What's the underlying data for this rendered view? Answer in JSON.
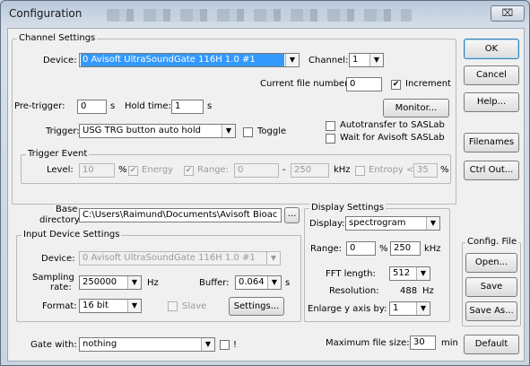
{
  "window": {
    "title": "Configuration",
    "close_glyph": "⌧"
  },
  "channel_settings": {
    "legend": "Channel Settings",
    "device_label": "Device:",
    "device_value": "0 Avisoft UltraSoundGate 116H 1.0 #1",
    "channel_label": "Channel:",
    "channel_value": "1",
    "current_file_label": "Current file number:",
    "current_file_value": "0",
    "increment_label": "Increment",
    "increment_checked": "✔",
    "pretrigger_label": "Pre-trigger:",
    "pretrigger_value": "0",
    "pretrigger_unit": "s",
    "holdtime_label": "Hold time:",
    "holdtime_value": "1",
    "holdtime_unit": "s",
    "monitor_button": "Monitor...",
    "autotransfer_label": "Autotransfer to SASLab",
    "wait_label": "Wait for Avisoft SASLab",
    "trigger_label": "Trigger:",
    "trigger_value": "USG TRG button auto hold",
    "toggle_label": "Toggle"
  },
  "trigger_event": {
    "legend": "Trigger Event",
    "level_label": "Level:",
    "level_value": "10",
    "percent": "%",
    "energy_checked": "✔",
    "energy_label": "Energy",
    "range_checked": "✔",
    "range_label": "Range:",
    "range_from": "0",
    "dash": "-",
    "range_to": "250",
    "khz": "kHz",
    "entropy_label": "Entropy <",
    "entropy_value": "35",
    "entropy_percent": "%"
  },
  "base_directory": {
    "label_line1": "Base",
    "label_line2": "directory:",
    "value": "C:\\Users\\Raimund\\Documents\\Avisoft Bioac",
    "browse_button": "..."
  },
  "input_device": {
    "legend": "Input Device Settings",
    "device_label": "Device:",
    "device_value": "0 Avisoft UltraSoundGate 116H 1.0 #1",
    "sampling_label_line1": "Sampling",
    "sampling_label_line2": "rate:",
    "sampling_value": "250000",
    "sampling_unit": "Hz",
    "buffer_label": "Buffer:",
    "buffer_value": "0.064",
    "buffer_unit": "s",
    "format_label": "Format:",
    "format_value": "16 bit",
    "slave_label": "Slave",
    "settings_button": "Settings..."
  },
  "display_settings": {
    "legend": "Display Settings",
    "display_label": "Display:",
    "display_value": "spectrogram",
    "range_label": "Range:",
    "range_from": "0",
    "percent": "%",
    "range_to": "250",
    "khz": "kHz",
    "fft_label": "FFT length:",
    "fft_value": "512",
    "resolution_label": "Resolution:",
    "resolution_value": "488",
    "resolution_unit": "Hz",
    "enlarge_label": "Enlarge y axis by:",
    "enlarge_value": "1"
  },
  "gate": {
    "label": "Gate with:",
    "value": "nothing",
    "bang": "!"
  },
  "max_file_size": {
    "label": "Maximum file size:",
    "value": "30",
    "unit": "min"
  },
  "buttons": {
    "ok": "OK",
    "cancel": "Cancel",
    "help": "Help...",
    "filenames": "Filenames",
    "ctrl_out": "Ctrl Out...",
    "default": "Default"
  },
  "config_file": {
    "legend": "Config. File",
    "open": "Open...",
    "save": "Save",
    "save_as": "Save As..."
  },
  "icons": {
    "dropdown": "▼"
  }
}
